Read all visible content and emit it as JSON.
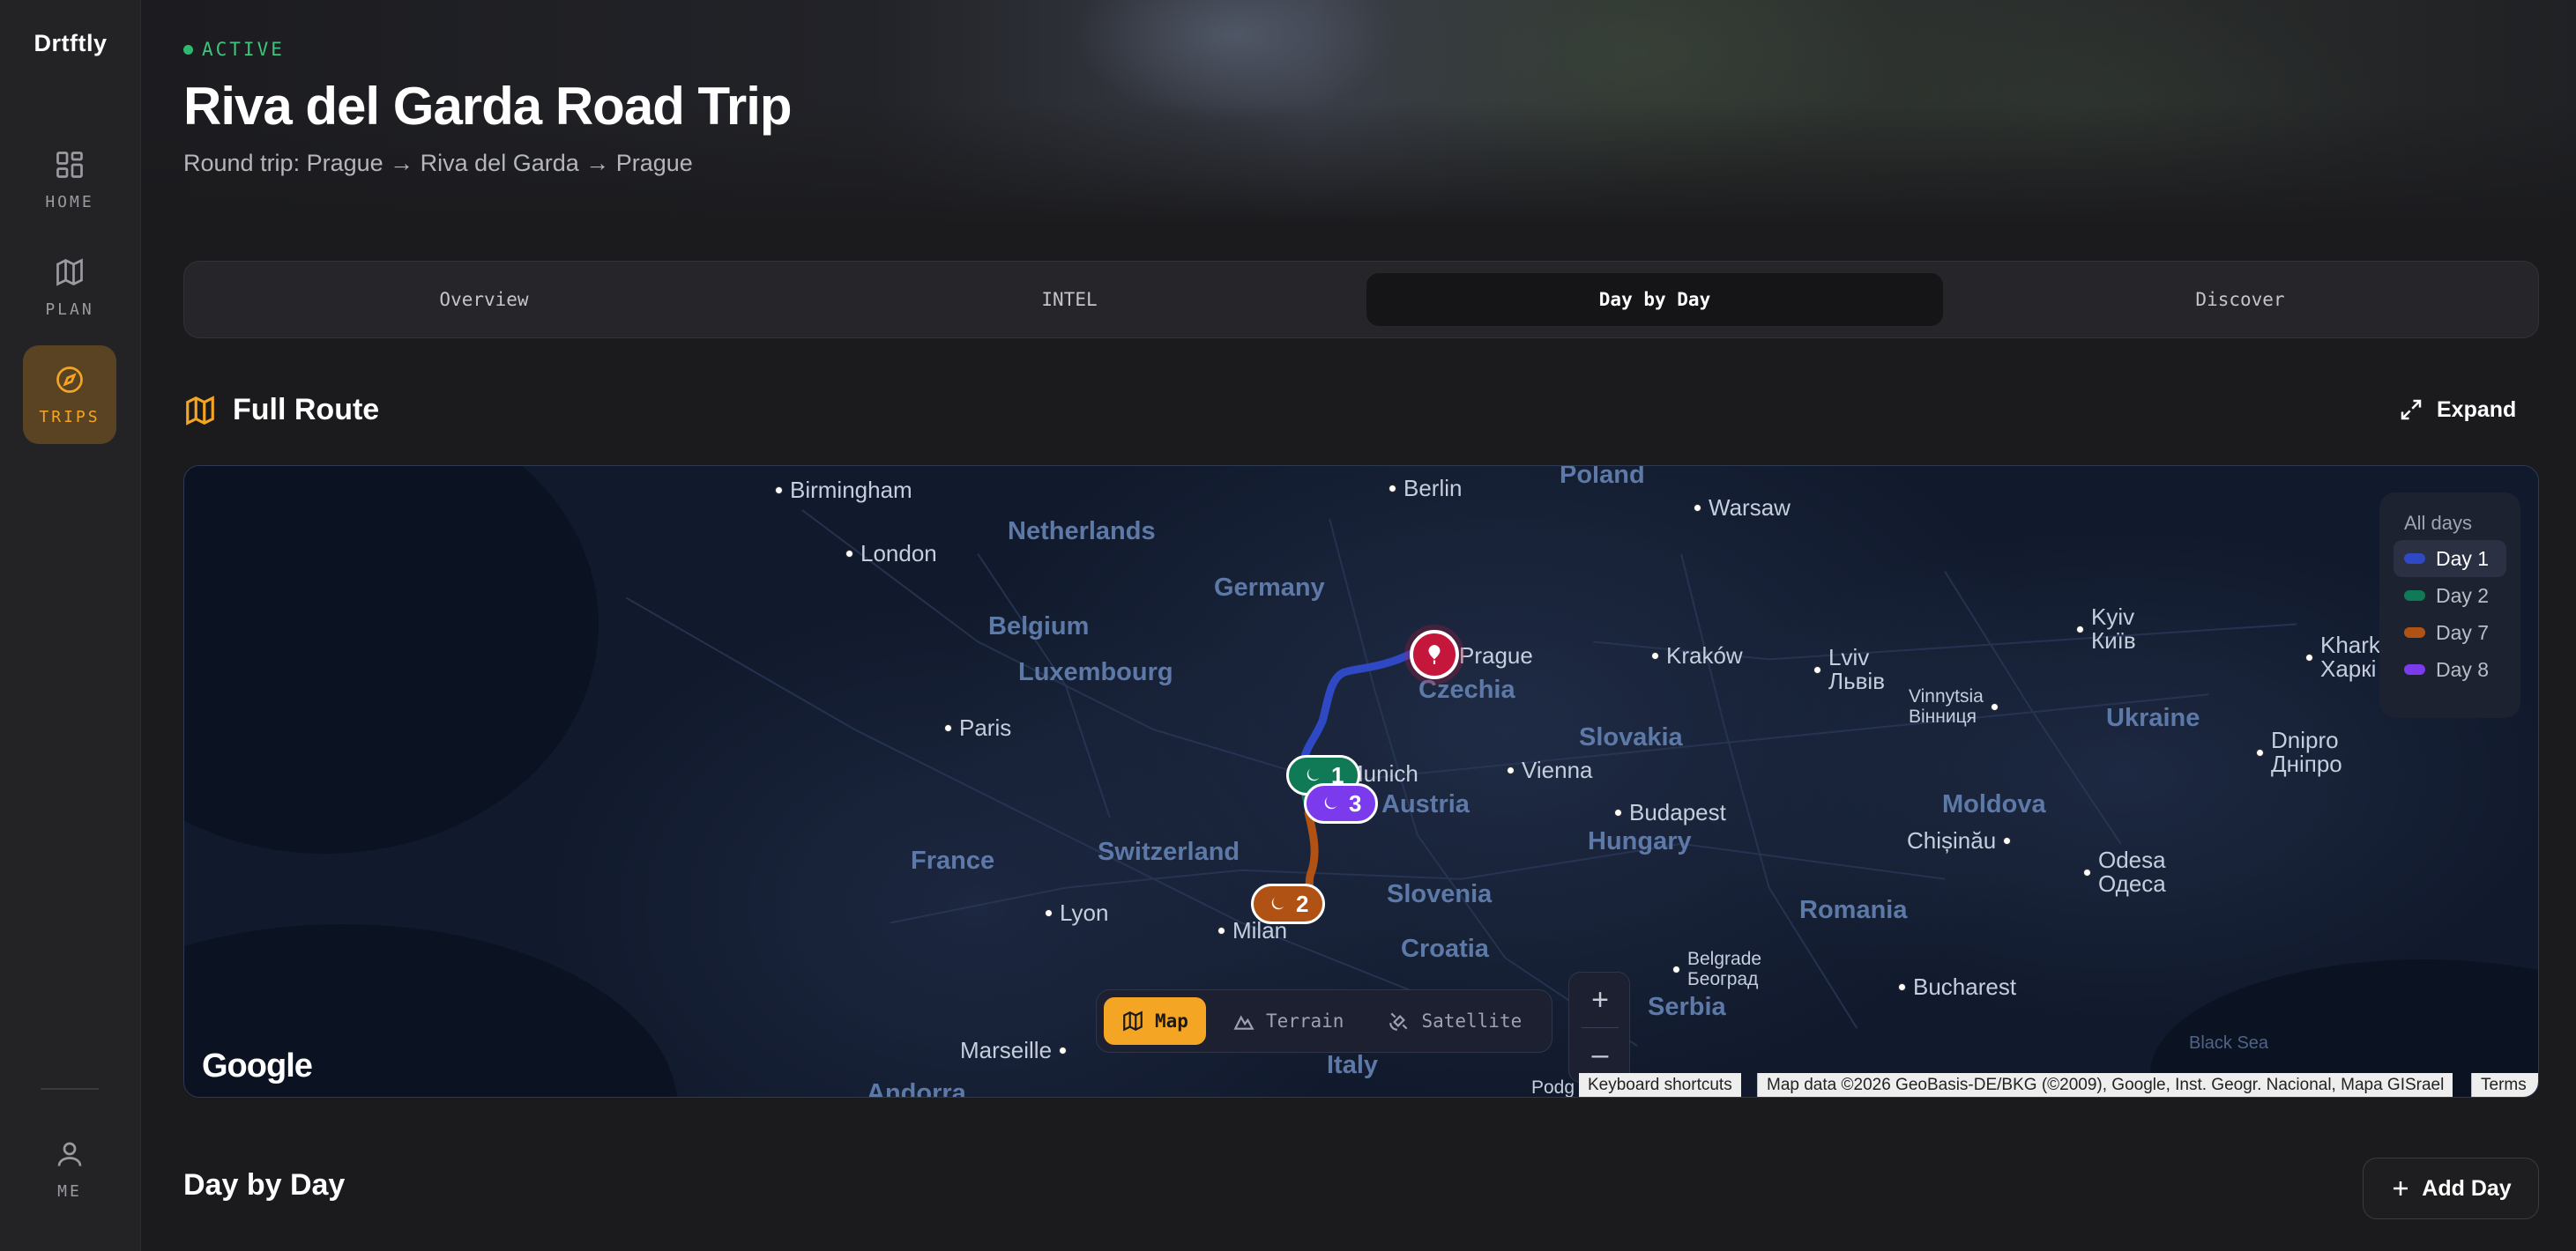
{
  "app": {
    "brand": "Drtftly"
  },
  "sidebar": {
    "items": [
      {
        "label": "HOME",
        "icon": "grid-icon"
      },
      {
        "label": "PLAN",
        "icon": "map-icon"
      },
      {
        "label": "TRIPS",
        "icon": "compass-icon",
        "active": true
      }
    ],
    "profile": {
      "label": "ME",
      "icon": "user-icon"
    }
  },
  "trip": {
    "status": "ACTIVE",
    "title": "Riva del Garda Road Trip",
    "subtitle": "Round trip: Prague → Riva del Garda → Prague"
  },
  "tabs": [
    {
      "label": "Overview"
    },
    {
      "label": "INTEL"
    },
    {
      "label": "Day by Day",
      "active": true
    },
    {
      "label": "Discover"
    }
  ],
  "route": {
    "title": "Full Route",
    "expand_label": "Expand"
  },
  "map": {
    "countries": [
      "Poland",
      "Netherlands",
      "Germany",
      "Belgium",
      "Luxembourg",
      "Czechia",
      "Slovakia",
      "Ukraine",
      "Austria",
      "Hungary",
      "Moldova",
      "France",
      "Switzerland",
      "Slovenia",
      "Romania",
      "Croatia",
      "Serbia",
      "Italy",
      "Andorra"
    ],
    "cities": [
      "Birmingham",
      "Berlin",
      "Warsaw",
      "London",
      "Prague",
      "Kraków",
      "Lviv",
      "Львів",
      "Kyiv",
      "Київ",
      "Khark",
      "Харкі",
      "Vinnytsia",
      "Вінниця",
      "Paris",
      "Munich",
      "Vienna",
      "Budapest",
      "Dnipro",
      "Дніпро",
      "Chișinău",
      "Odesa",
      "Одеса",
      "Lyon",
      "Milan",
      "Belgrade",
      "Београд",
      "Bucharest",
      "Marseille",
      "Podg"
    ],
    "sea": "Black Sea",
    "legend": {
      "title": "All days",
      "items": [
        {
          "label": "Day 1",
          "color": "#2f49c4",
          "selected": true
        },
        {
          "label": "Day 2",
          "color": "#0f7a55"
        },
        {
          "label": "Day 7",
          "color": "#b05214"
        },
        {
          "label": "Day 8",
          "color": "#7c3aed"
        }
      ]
    },
    "markers": [
      {
        "label": "1",
        "color": "#0f7a55"
      },
      {
        "label": "3",
        "color": "#7c3aed"
      },
      {
        "label": "2",
        "color": "#b05214"
      }
    ],
    "map_types": [
      {
        "label": "Map",
        "active": true
      },
      {
        "label": "Terrain"
      },
      {
        "label": "Satellite"
      }
    ],
    "zoom_in": "+",
    "zoom_out": "–",
    "google_logo": "Google",
    "attribution": {
      "shortcuts": "Keyboard shortcuts",
      "data": "Map data ©2026 GeoBasis-DE/BKG (©2009), Google, Inst. Geogr. Nacional, Mapa GISrael",
      "terms": "Terms"
    }
  },
  "day_by_day": {
    "title": "Day by Day",
    "add_label": "Add Day"
  }
}
